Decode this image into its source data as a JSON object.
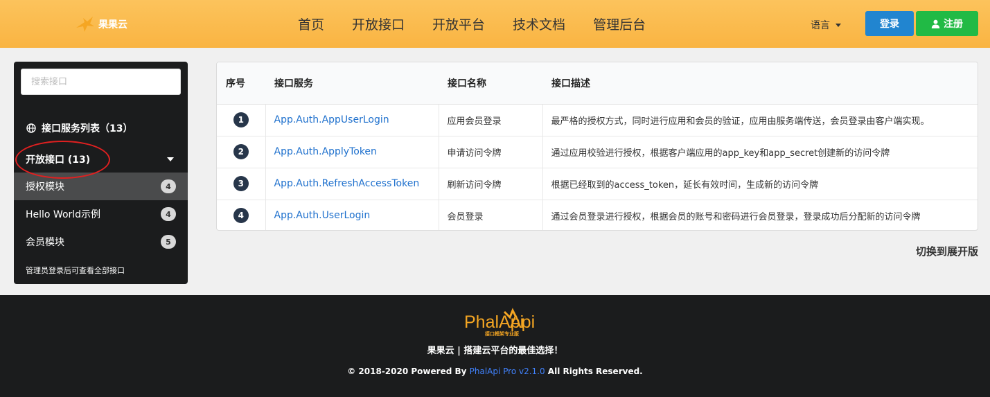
{
  "header": {
    "logo_text": "果果云",
    "nav": [
      "首页",
      "开放接口",
      "开放平台",
      "技术文档",
      "管理后台"
    ],
    "language_label": "语言",
    "login_label": "登录",
    "register_label": "注册"
  },
  "sidebar": {
    "search_placeholder": "搜索接口",
    "service_list_title": "接口服务列表（13）",
    "open_api_title": "开放接口 (13)",
    "items": [
      {
        "label": "授权模块",
        "count": "4"
      },
      {
        "label": "Hello World示例",
        "count": "4"
      },
      {
        "label": "会员模块",
        "count": "5"
      }
    ],
    "note": "管理员登录后可查看全部接口"
  },
  "table": {
    "headers": [
      "序号",
      "接口服务",
      "接口名称",
      "接口描述"
    ],
    "rows": [
      {
        "no": "1",
        "service": "App.Auth.AppUserLogin",
        "name": "应用会员登录",
        "desc": "最严格的授权方式，同时进行应用和会员的验证，应用由服务端传送，会员登录由客户端实现。"
      },
      {
        "no": "2",
        "service": "App.Auth.ApplyToken",
        "name": "申请访问令牌",
        "desc": "通过应用校验进行授权，根据客户端应用的app_key和app_secret创建新的访问令牌"
      },
      {
        "no": "3",
        "service": "App.Auth.RefreshAccessToken",
        "name": "刷新访问令牌",
        "desc": "根据已经取到的access_token，延长有效时间，生成新的访问令牌"
      },
      {
        "no": "4",
        "service": "App.Auth.UserLogin",
        "name": "会员登录",
        "desc": "通过会员登录进行授权，根据会员的账号和密码进行会员登录，登录成功后分配新的访问令牌"
      }
    ]
  },
  "switch_label": "切换到展开版",
  "footer": {
    "logo_text": "PhalApi",
    "logo_sub": "接口框架专业版",
    "slogan": "果果云 | 搭建云平台的最佳选择！",
    "copyright_prefix": "© 2018-2020 Powered By ",
    "copyright_link": "PhalApi Pro v2.1.0",
    "copyright_suffix": " All Rights Reserved."
  },
  "colors": {
    "header_bg": "#fbbc52",
    "login_btn": "#2185d0",
    "register_btn": "#21ba45",
    "link": "#1e70cd",
    "annotation": "#e02020"
  }
}
